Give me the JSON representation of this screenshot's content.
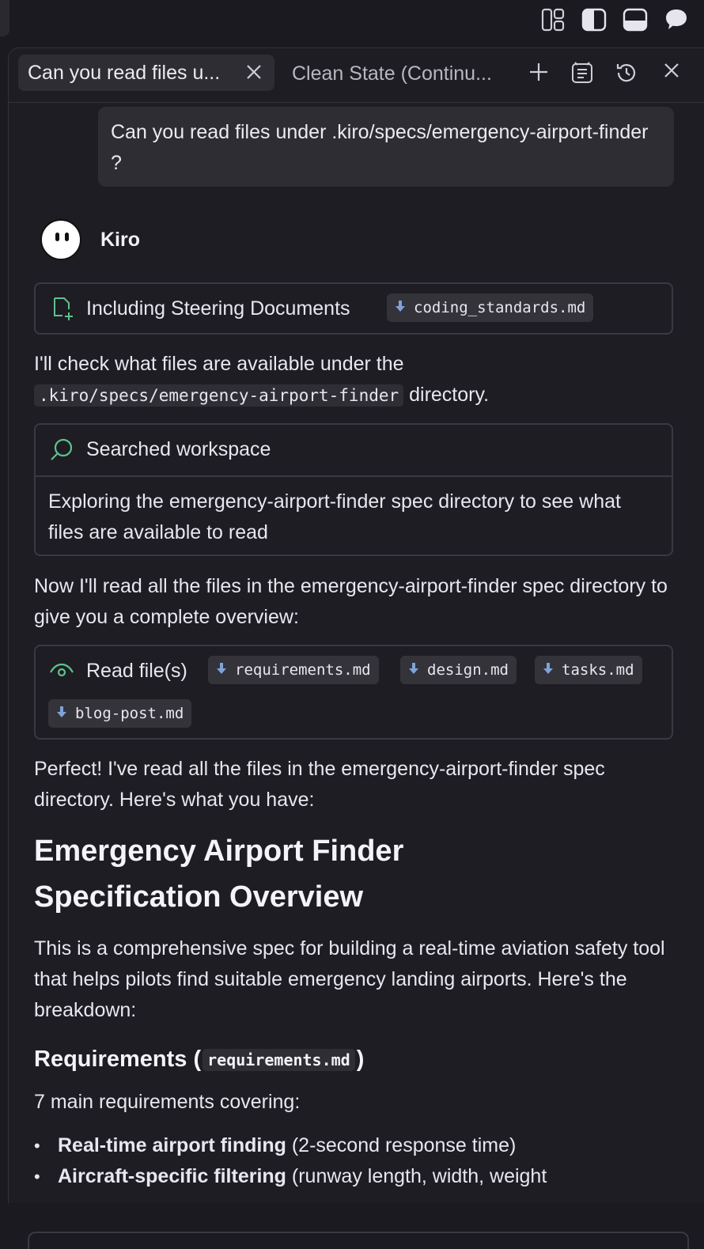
{
  "tabs": {
    "active_label": "Can you read files u...",
    "inactive_label": "Clean State (Continu..."
  },
  "user_message": "Can you read files under .kiro/specs/emergency-airport-finder ?",
  "assistant": {
    "name": "Kiro"
  },
  "steering": {
    "label": "Including Steering Documents",
    "file": "coding_standards.md"
  },
  "para1": {
    "text": "I'll check what files are available under the",
    "code": ".kiro/specs/emergency-airport-finder",
    "suffix": "directory."
  },
  "search_card": {
    "title": "Searched workspace",
    "body": "Exploring the emergency-airport-finder spec directory to see what files are available to read"
  },
  "para2": "Now I'll read all the files in the emergency-airport-finder spec directory to give you a complete overview:",
  "read_card": {
    "label": "Read file(s)",
    "files": [
      "requirements.md",
      "design.md",
      "tasks.md",
      "blog-post.md"
    ]
  },
  "para3": "Perfect! I've read all the files in the emergency-airport-finder spec directory. Here's what you have:",
  "heading": "Emergency Airport Finder Specification Overview",
  "para4": "This is a comprehensive spec for building a real-time aviation safety tool that helps pilots find suitable emergency landing airports. Here's the breakdown:",
  "section": {
    "title": "Requirements (",
    "code": "requirements.md",
    "close": ")"
  },
  "para5": "7 main requirements covering:",
  "bullets": [
    {
      "bold": "Real-time airport finding",
      "rest": " (2-second response time)"
    },
    {
      "bold": "Aircraft-specific filtering",
      "rest": " (runway length, width, weight"
    }
  ],
  "icons": {
    "top": [
      "layout-grid-icon",
      "sidebar-left-icon",
      "panel-bottom-icon",
      "chat-icon"
    ],
    "tab_actions": [
      "add-icon",
      "checklist-icon",
      "history-icon",
      "close-icon"
    ],
    "accent": "#5ec28f"
  }
}
